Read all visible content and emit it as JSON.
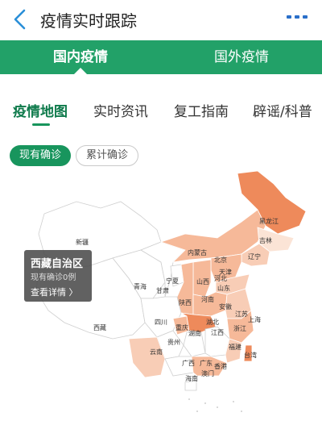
{
  "header": {
    "title": "疫情实时跟踪",
    "back_icon": "chevron-left-icon",
    "more_icon": "ellipsis-icon"
  },
  "main_tabs": [
    {
      "label": "国内疫情",
      "active": true
    },
    {
      "label": "国外疫情",
      "active": false
    }
  ],
  "sub_tabs": [
    {
      "label": "疫情地图",
      "active": true
    },
    {
      "label": "实时资讯",
      "active": false
    },
    {
      "label": "复工指南",
      "active": false
    },
    {
      "label": "辟谣/科普",
      "active": false
    }
  ],
  "filters": {
    "current": "现有确诊",
    "cumulative": "累计确诊"
  },
  "tooltip": {
    "province": "西藏自治区",
    "detail": "现有确诊0例",
    "link": "查看详情 〉"
  },
  "map_labels": {
    "heilongjiang": "黑龙江",
    "jilin": "吉林",
    "liaoning": "辽宁",
    "neimenggu": "内蒙古",
    "beijing": "北京",
    "tianjin": "天津",
    "hebei": "河北",
    "shanxi": "山西",
    "shandong": "山东",
    "xinjiang": "新疆",
    "qinghai": "青海",
    "gansu": "甘肃",
    "ningxia": "宁夏",
    "shaanxi": "陕西",
    "henan": "河南",
    "jiangsu": "江苏",
    "anhui": "安徽",
    "shanghai": "上海",
    "xizang": "西藏",
    "sichuan": "四川",
    "chongqing": "重庆",
    "hubei": "湖北",
    "zhejiang": "浙江",
    "guizhou": "贵州",
    "hunan": "湖南",
    "jiangxi": "江西",
    "fujian": "福建",
    "yunnan": "云南",
    "guangxi": "广西",
    "guangdong": "广东",
    "taiwan": "台湾",
    "hongkong": "香港",
    "macao": "澳门",
    "hainan": "海南"
  },
  "colors": {
    "brand_green": "#22a168",
    "dark_green": "#18955d",
    "map_light": "#fbe4d6",
    "map_mid": "#f6b999",
    "map_dark": "#ee8a5b"
  }
}
